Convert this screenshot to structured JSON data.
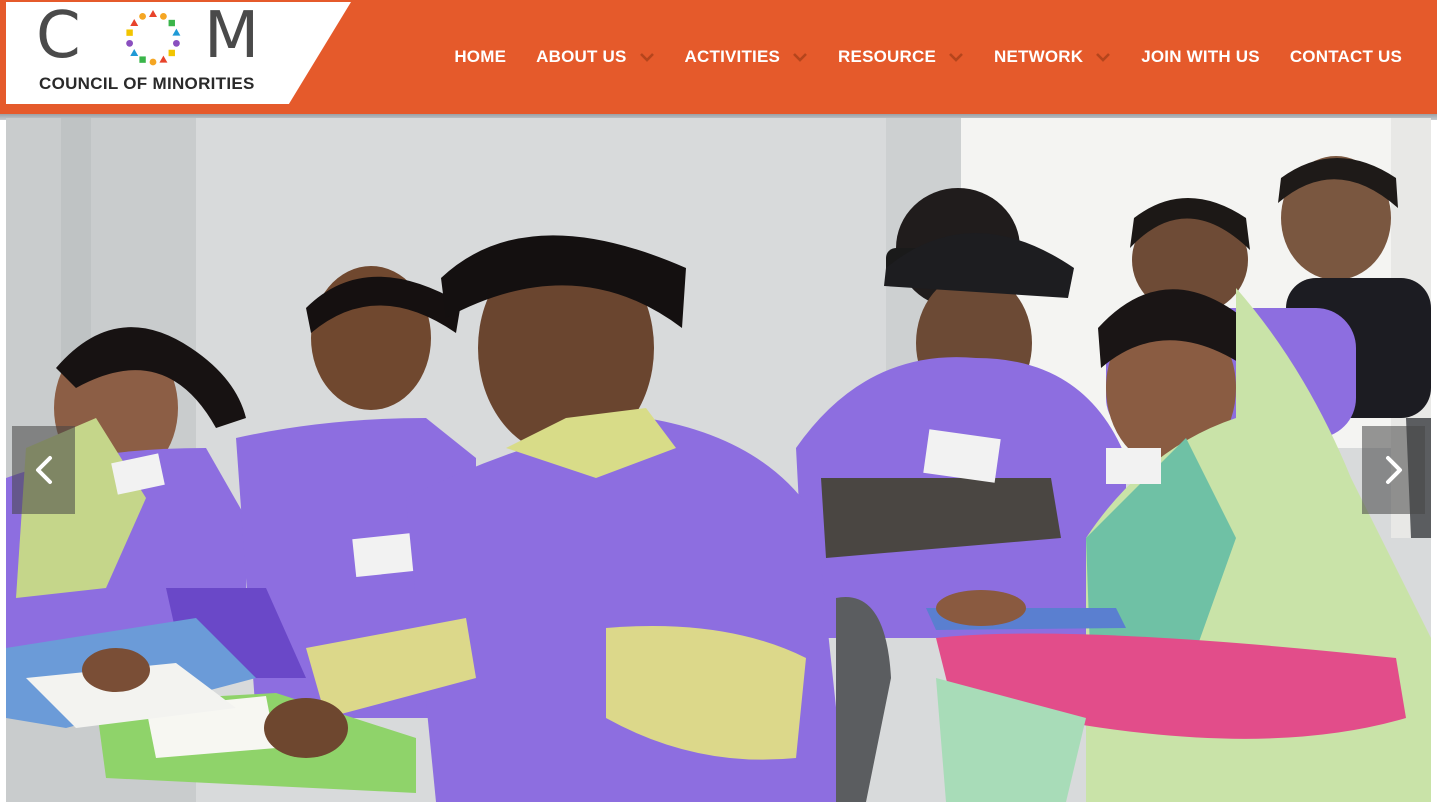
{
  "logo": {
    "mark_left": "C",
    "mark_right": "M",
    "tagline": "COUNCIL OF MINORITIES",
    "ring_colors": [
      "#e8432b",
      "#f5a623",
      "#3ab54a",
      "#1f9ad6",
      "#8a4fbf",
      "#f2c500"
    ]
  },
  "nav": {
    "items": [
      {
        "label": "HOME",
        "has_dropdown": false
      },
      {
        "label": "ABOUT US",
        "has_dropdown": true
      },
      {
        "label": "ACTIVITIES",
        "has_dropdown": true
      },
      {
        "label": "RESOURCE",
        "has_dropdown": true
      },
      {
        "label": "NETWORK",
        "has_dropdown": true
      },
      {
        "label": "JOIN WITH US",
        "has_dropdown": false
      },
      {
        "label": "CONTACT US",
        "has_dropdown": false
      }
    ],
    "chevron_icon": "chevron-down-icon"
  },
  "slider": {
    "prev_icon": "chevron-left-icon",
    "next_icon": "chevron-right-icon"
  },
  "colors": {
    "header_bg": "#e55a2b",
    "shirt_purple": "#8d6ee0",
    "chevron": "#b5451c"
  }
}
